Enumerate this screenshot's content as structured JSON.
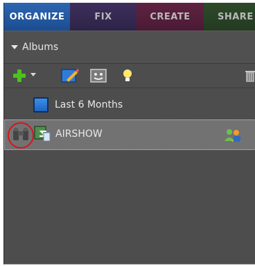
{
  "tabs": [
    {
      "label": "ORGANIZE",
      "active": true
    },
    {
      "label": "FIX"
    },
    {
      "label": "CREATE"
    },
    {
      "label": "SHARE"
    }
  ],
  "albums_panel": {
    "header": "Albums",
    "toolbar": [
      "plus-icon",
      "dropdown-icon",
      "edit-icon",
      "smart-album-icon",
      "bulb-icon",
      "trash-icon"
    ],
    "items": [
      {
        "label": "Last 6 Months",
        "icon": "blue-square-icon"
      },
      {
        "label": "AIRSHOW",
        "icon": "binoculars-icon",
        "selected": true,
        "highlight": "red-circle"
      }
    ]
  },
  "colors": {
    "organize_tab": "#1f5aa6",
    "panel_bg": "#4d4d4d",
    "selected_row": "#727272",
    "highlight": "#d4161c"
  }
}
